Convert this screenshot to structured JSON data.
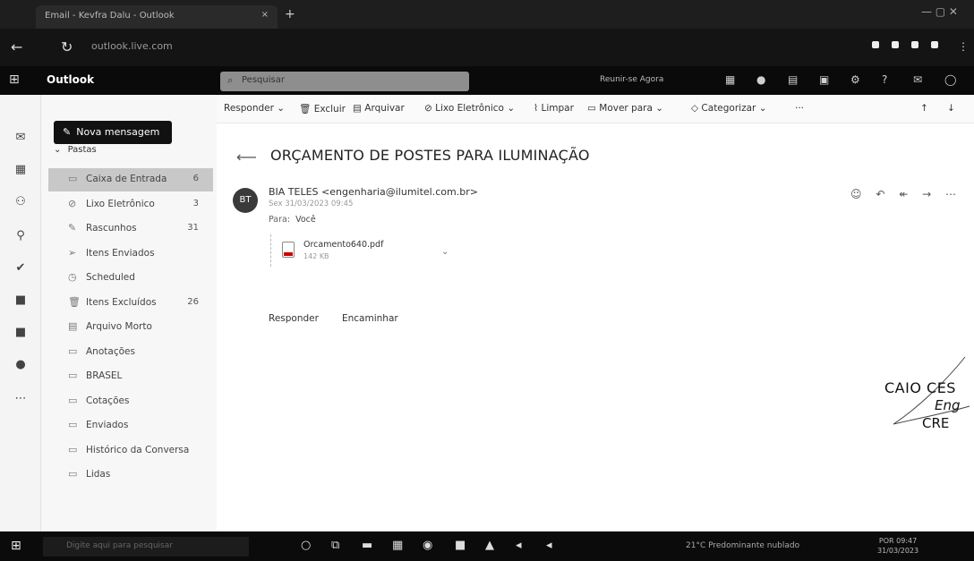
{
  "browser": {
    "tab_title": "Email - Kevfra Dalu - Outlook",
    "tab_close": "×",
    "new_tab": "+",
    "url": "outlook.live.com"
  },
  "outlook": {
    "app_name": "Outlook",
    "search_placeholder": "Pesquisar",
    "meet_now": "Reunir-se Agora"
  },
  "folders": {
    "new_message": "Nova mensagem",
    "section": "Pastas",
    "items": [
      {
        "label": "Caixa de Entrada",
        "count": "6",
        "icon": "inbox-icon",
        "glyph": "▭",
        "selected": true
      },
      {
        "label": "Lixo Eletrônico",
        "count": "3",
        "icon": "junk-icon",
        "glyph": "⊘",
        "selected": false
      },
      {
        "label": "Rascunhos",
        "count": "31",
        "icon": "drafts-icon",
        "glyph": "✎",
        "selected": false
      },
      {
        "label": "Itens Enviados",
        "count": "",
        "icon": "sent-icon",
        "glyph": "➢",
        "selected": false
      },
      {
        "label": "Scheduled",
        "count": "",
        "icon": "clock-icon",
        "glyph": "◷",
        "selected": false
      },
      {
        "label": "Itens Excluídos",
        "count": "26",
        "icon": "trash-icon",
        "glyph": "🗑",
        "selected": false
      },
      {
        "label": "Arquivo Morto",
        "count": "",
        "icon": "archive-icon",
        "glyph": "▤",
        "selected": false
      },
      {
        "label": "Anotações",
        "count": "",
        "icon": "notes-icon",
        "glyph": "▭",
        "selected": false
      },
      {
        "label": "BRASEL",
        "count": "",
        "icon": "folder-icon",
        "glyph": "▭",
        "selected": false
      },
      {
        "label": "Cotações",
        "count": "",
        "icon": "folder-icon",
        "glyph": "▭",
        "selected": false
      },
      {
        "label": "Enviados",
        "count": "",
        "icon": "folder-icon",
        "glyph": "▭",
        "selected": false
      },
      {
        "label": "Histórico da Conversa",
        "count": "",
        "icon": "folder-icon",
        "glyph": "▭",
        "selected": false
      },
      {
        "label": "Lidas",
        "count": "",
        "icon": "folder-icon",
        "glyph": "▭",
        "selected": false
      }
    ]
  },
  "toolbar": {
    "reply": "Responder",
    "delete": "Excluir",
    "archive": "Arquivar",
    "junk": "Lixo Eletrônico",
    "sweep": "Limpar",
    "move_to": "Mover para",
    "categorize": "Categorizar",
    "more": "···"
  },
  "message": {
    "subject": "ORÇAMENTO DE POSTES PARA ILUMINAÇÃO",
    "avatar_initials": "BT",
    "sender": "BIA TELES <engenharia@ilumitel.com.br>",
    "sent_date": "Sex 31/03/2023 09:45",
    "to_label": "Para:",
    "to_value": "Você",
    "attachment_name": "Orcamento640.pdf",
    "attachment_size": "142 KB",
    "reply_link": "Responder",
    "forward_link": "Encaminhar"
  },
  "stamp": {
    "line1": "CAIO CES",
    "line2": "Eng",
    "line3": "CRE"
  },
  "taskbar": {
    "search_placeholder": "Digite aqui para pesquisar",
    "weather": "21°C Predominante nublado",
    "time": "09:47",
    "date": "31/03/2023",
    "lang": "POR"
  }
}
